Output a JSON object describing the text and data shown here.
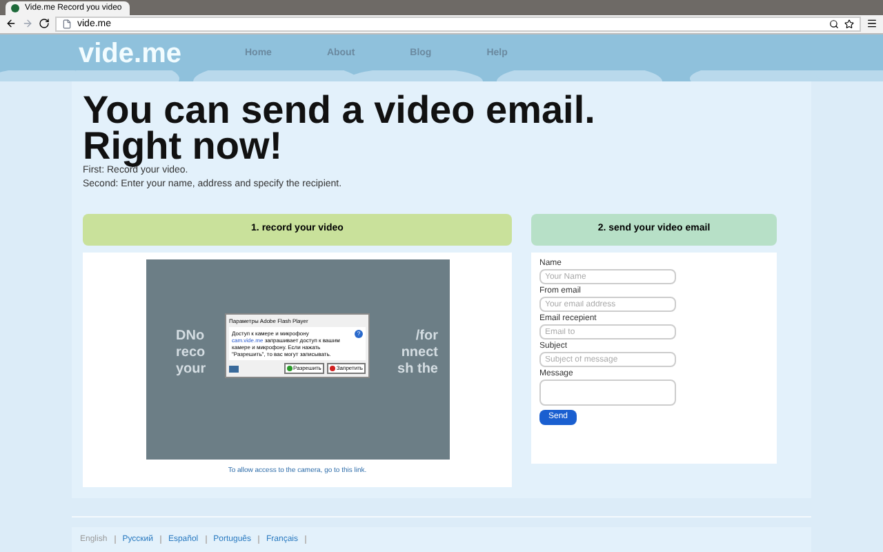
{
  "browser": {
    "tab_title": "Vide.me Record you video",
    "address": "vide.me"
  },
  "header": {
    "logo": "vide.me",
    "nav": [
      {
        "label": "Home"
      },
      {
        "label": "About"
      },
      {
        "label": "Blog"
      },
      {
        "label": "Help"
      }
    ]
  },
  "hero": {
    "title_lines": [
      "You can send a video email.",
      "Right now!"
    ],
    "steps": [
      "First: Record your video.",
      "Second: Enter your name, address and specify the recipient."
    ]
  },
  "record": {
    "heading": "1. record your video",
    "video_text_left": [
      "DNo",
      "reco",
      "your"
    ],
    "video_text_right": [
      "/for",
      "nnect",
      "sh the"
    ],
    "flash_dialog": {
      "title": "Параметры Adobe Flash Player",
      "heading": "Доступ к камере и микрофону",
      "site": "cam.vide.me",
      "body": "запрашивает доступ к вашим камере и микрофону. Если нажать \"Разрешить\", то вас могут записывать.",
      "help": "?",
      "buttons": [
        {
          "label": "Разрешить",
          "kind": "allow"
        },
        {
          "label": "Запретить",
          "kind": "deny"
        }
      ]
    },
    "hint": "To allow access to the camera, go to this link."
  },
  "send": {
    "heading": "2. send your video email",
    "fields": [
      {
        "label": "Name",
        "placeholder": "Your Name",
        "kind": "input"
      },
      {
        "label": "From email",
        "placeholder": "Your email address",
        "kind": "input"
      },
      {
        "label": "Email recepient",
        "placeholder": "Email to",
        "kind": "input"
      },
      {
        "label": "Subject",
        "placeholder": "Subject of message",
        "kind": "input"
      },
      {
        "label": "Message",
        "kind": "textarea"
      }
    ],
    "button": "Send"
  },
  "footer": {
    "languages": [
      {
        "label": "English",
        "selected": true
      },
      {
        "label": "Русский",
        "selected": false
      },
      {
        "label": "Español",
        "selected": false
      },
      {
        "label": "Português",
        "selected": false
      },
      {
        "label": "Français",
        "selected": false
      }
    ]
  }
}
